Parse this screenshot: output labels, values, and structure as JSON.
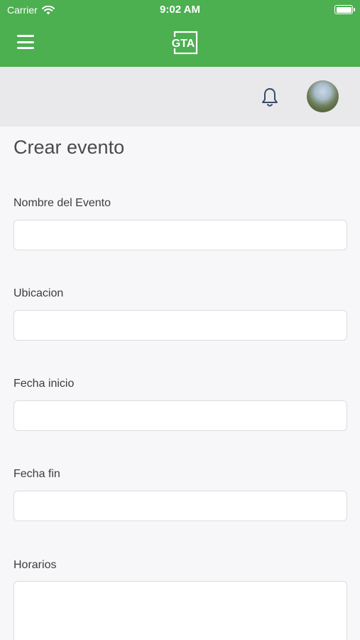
{
  "status_bar": {
    "carrier": "Carrier",
    "time": "9:02 AM"
  },
  "header": {
    "logo_text": "GTA"
  },
  "page": {
    "title": "Crear evento"
  },
  "form": {
    "fields": [
      {
        "label": "Nombre del Evento",
        "value": "",
        "placeholder": ""
      },
      {
        "label": "Ubicacion",
        "value": "",
        "placeholder": ""
      },
      {
        "label": "Fecha inicio",
        "value": "",
        "placeholder": ""
      },
      {
        "label": "Fecha fin",
        "value": "",
        "placeholder": ""
      },
      {
        "label": "Horarios",
        "value": "",
        "placeholder": ""
      }
    ]
  },
  "colors": {
    "brand": "#4caf50",
    "subheader": "#e9e9ec",
    "icon": "#3a4a6b"
  },
  "icons": {
    "menu": "hamburger-icon",
    "notifications": "bell-icon",
    "wifi": "wifi-icon",
    "battery": "battery-icon"
  }
}
